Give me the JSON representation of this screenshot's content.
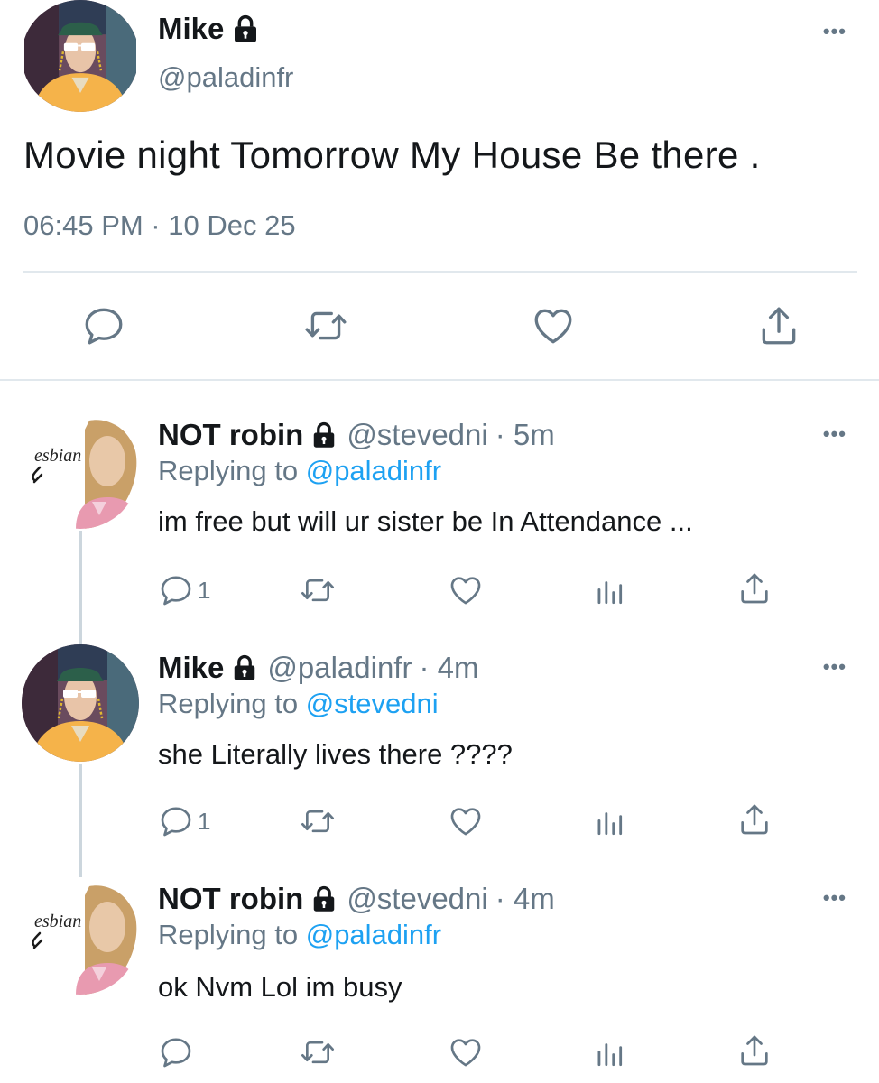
{
  "main_tweet": {
    "author_name": "Mike",
    "author_handle": "@paladinfr",
    "text": "Movie night Tomorrow My House Be there .",
    "timestamp": "06:45 PM · 10 Dec 25",
    "more_icon": "more-horizontal-icon",
    "actions": [
      "reply-icon",
      "retweet-icon",
      "like-icon",
      "share-icon"
    ]
  },
  "replies": [
    {
      "author_name": "NOT robin",
      "author_handle": "@stevedni",
      "time": "· 5m",
      "replying_prefix": "Replying to ",
      "replying_to": "@paladinfr",
      "text": "im free but will ur sister be In Attendance ...",
      "reply_count": "1",
      "avatar_text": "esbian"
    },
    {
      "author_name": "Mike",
      "author_handle": "@paladinfr",
      "time": "· 4m",
      "replying_prefix": "Replying to ",
      "replying_to": "@stevedni",
      "text": "she Literally lives there ????",
      "reply_count": "1"
    },
    {
      "author_name": "NOT robin",
      "author_handle": "@stevedni",
      "time": "· 4m",
      "replying_prefix": "Replying to ",
      "replying_to": "@paladinfr",
      "text": "ok Nvm Lol im busy",
      "reply_count": "",
      "avatar_text": "esbian"
    }
  ],
  "colors": {
    "text": "#14171a",
    "secondary": "#657786",
    "link": "#1da1f2",
    "divider": "#e1e8ed"
  }
}
